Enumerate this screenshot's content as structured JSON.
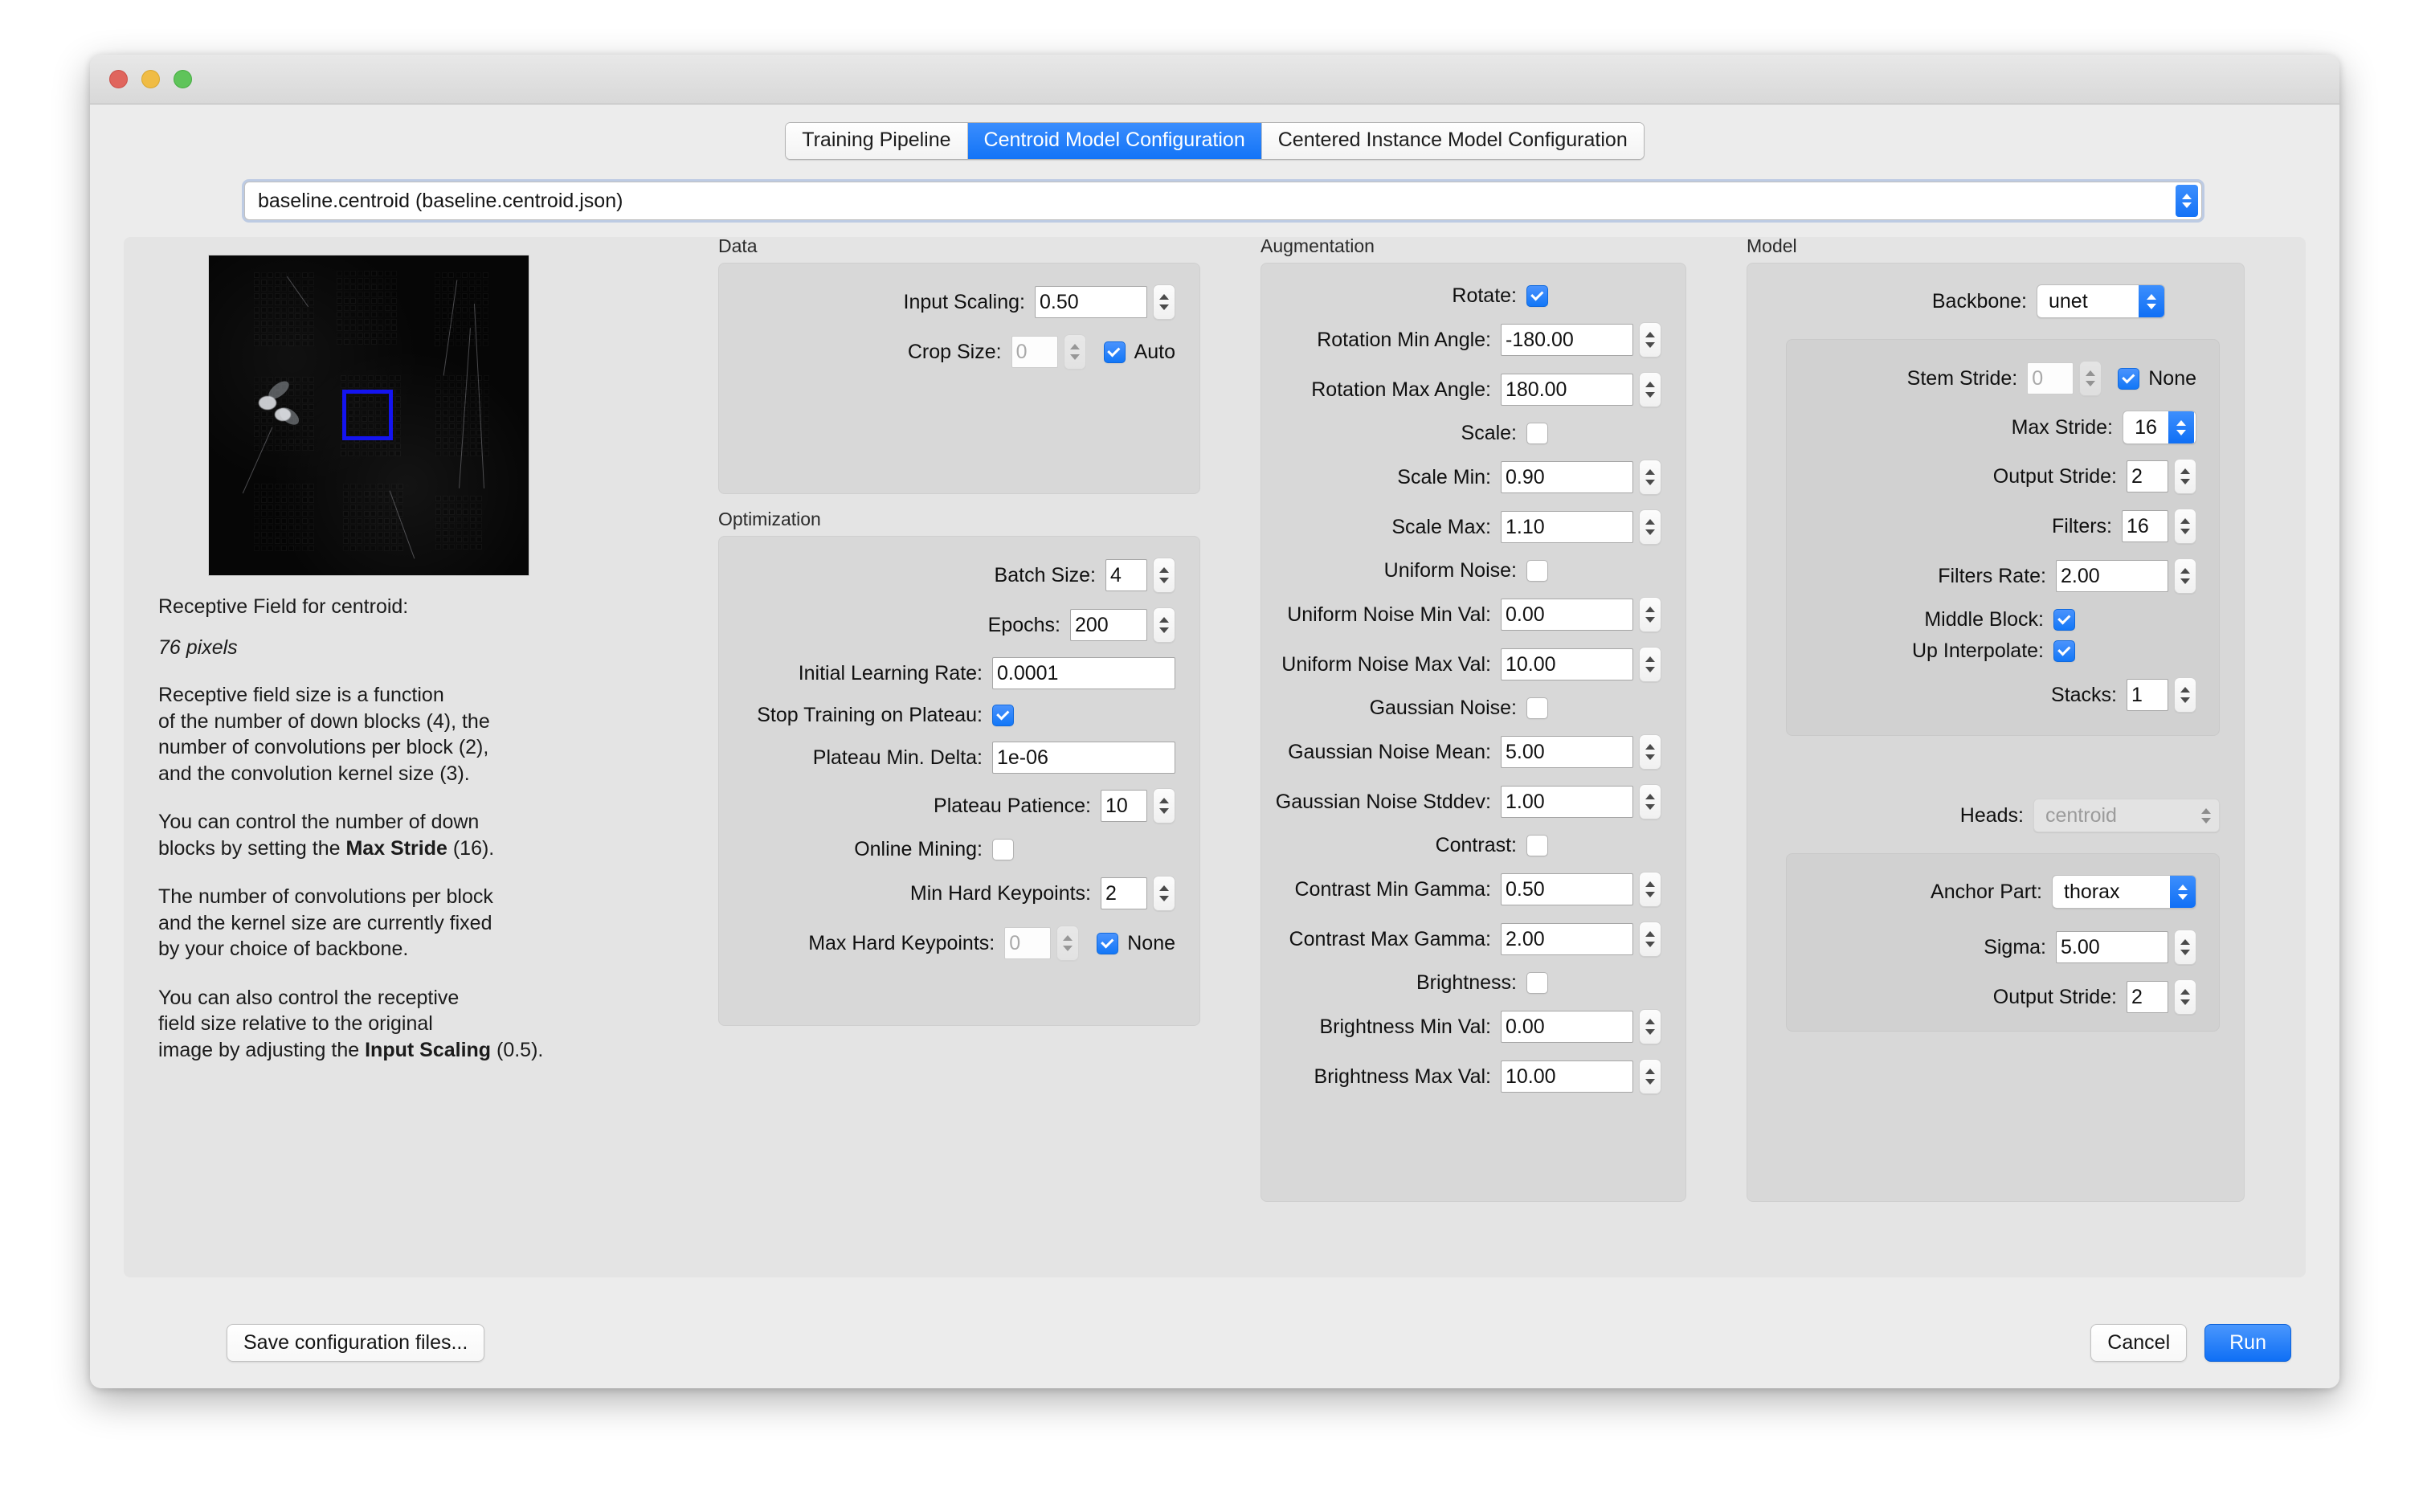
{
  "window": {
    "traffic_lights": [
      "close",
      "minimize",
      "zoom"
    ]
  },
  "tabs": [
    {
      "label": "Training Pipeline",
      "active": false
    },
    {
      "label": "Centroid Model Configuration",
      "active": true
    },
    {
      "label": "Centered Instance Model Configuration",
      "active": false
    }
  ],
  "config_selector": {
    "value": "baseline.centroid (baseline.centroid.json)"
  },
  "preview": {
    "caption_title": "Receptive Field for centroid:",
    "caption_value": "76 pixels",
    "para1_a": "Receptive field size is a function",
    "para1_b": "of the number of down blocks (4), the",
    "para1_c": "number of convolutions per block (2),",
    "para1_d": "and the convolution kernel size (3).",
    "para2_a": "You can control the number of down",
    "para2_b_pre": "blocks by setting the ",
    "para2_b_bold": "Max Stride",
    "para2_b_post": " (16).",
    "para3_a": "The number of convolutions per block",
    "para3_b": "and the kernel size are currently fixed",
    "para3_c": "by your choice of backbone.",
    "para4_a": "You can also control the receptive",
    "para4_b": "field size relative to the original",
    "para4_c_pre": "image by adjusting the ",
    "para4_c_bold": "Input Scaling",
    "para4_c_post": " (0.5)."
  },
  "data_section": {
    "title": "Data",
    "input_scaling": {
      "label": "Input Scaling:",
      "value": "0.50"
    },
    "crop_size": {
      "label": "Crop Size:",
      "value": "0",
      "disabled": true,
      "auto_label": "Auto",
      "auto_checked": true
    }
  },
  "optimization_section": {
    "title": "Optimization",
    "batch_size": {
      "label": "Batch Size:",
      "value": "4"
    },
    "epochs": {
      "label": "Epochs:",
      "value": "200"
    },
    "initial_learning_rate": {
      "label": "Initial Learning Rate:",
      "value": "0.0001"
    },
    "stop_training_on_plateau": {
      "label": "Stop Training on Plateau:",
      "checked": true
    },
    "plateau_min_delta": {
      "label": "Plateau Min. Delta:",
      "value": "1e-06"
    },
    "plateau_patience": {
      "label": "Plateau Patience:",
      "value": "10"
    },
    "online_mining": {
      "label": "Online Mining:",
      "checked": false
    },
    "min_hard_keypoints": {
      "label": "Min Hard Keypoints:",
      "value": "2"
    },
    "max_hard_keypoints": {
      "label": "Max Hard Keypoints:",
      "value": "0",
      "disabled": true,
      "none_label": "None",
      "none_checked": true
    }
  },
  "augmentation_section": {
    "title": "Augmentation",
    "rotate": {
      "label": "Rotate:",
      "checked": true
    },
    "rotation_min_angle": {
      "label": "Rotation Min Angle:",
      "value": "-180.00"
    },
    "rotation_max_angle": {
      "label": "Rotation Max Angle:",
      "value": "180.00"
    },
    "scale": {
      "label": "Scale:",
      "checked": false
    },
    "scale_min": {
      "label": "Scale Min:",
      "value": "0.90"
    },
    "scale_max": {
      "label": "Scale Max:",
      "value": "1.10"
    },
    "uniform_noise": {
      "label": "Uniform Noise:",
      "checked": false
    },
    "uniform_noise_min_val": {
      "label": "Uniform Noise Min Val:",
      "value": "0.00"
    },
    "uniform_noise_max_val": {
      "label": "Uniform Noise Max Val:",
      "value": "10.00"
    },
    "gaussian_noise": {
      "label": "Gaussian Noise:",
      "checked": false
    },
    "gaussian_noise_mean": {
      "label": "Gaussian Noise Mean:",
      "value": "5.00"
    },
    "gaussian_noise_stddev": {
      "label": "Gaussian Noise Stddev:",
      "value": "1.00"
    },
    "contrast": {
      "label": "Contrast:",
      "checked": false
    },
    "contrast_min_gamma": {
      "label": "Contrast Min Gamma:",
      "value": "0.50"
    },
    "contrast_max_gamma": {
      "label": "Contrast Max Gamma:",
      "value": "2.00"
    },
    "brightness": {
      "label": "Brightness:",
      "checked": false
    },
    "brightness_min_val": {
      "label": "Brightness Min Val:",
      "value": "0.00"
    },
    "brightness_max_val": {
      "label": "Brightness Max Val:",
      "value": "10.00"
    }
  },
  "model_section": {
    "title": "Model",
    "backbone": {
      "label": "Backbone:",
      "value": "unet"
    },
    "stem_stride": {
      "label": "Stem Stride:",
      "value": "0",
      "disabled": true,
      "none_label": "None",
      "none_checked": true
    },
    "max_stride": {
      "label": "Max Stride:",
      "value": "16"
    },
    "output_stride": {
      "label": "Output Stride:",
      "value": "2"
    },
    "filters": {
      "label": "Filters:",
      "value": "16"
    },
    "filters_rate": {
      "label": "Filters Rate:",
      "value": "2.00"
    },
    "middle_block": {
      "label": "Middle Block:",
      "checked": true
    },
    "up_interpolate": {
      "label": "Up Interpolate:",
      "checked": true
    },
    "stacks": {
      "label": "Stacks:",
      "value": "1"
    },
    "heads": {
      "label": "Heads:",
      "value": "centroid",
      "disabled": true
    },
    "anchor_part": {
      "label": "Anchor Part:",
      "value": "thorax"
    },
    "sigma": {
      "label": "Sigma:",
      "value": "5.00"
    },
    "head_output_stride": {
      "label": "Output Stride:",
      "value": "2"
    }
  },
  "footer": {
    "save_label": "Save configuration files...",
    "cancel_label": "Cancel",
    "run_label": "Run"
  },
  "colors": {
    "accent": "#1277f7",
    "window_bg": "#ececec",
    "panel_bg": "#d8d8d8",
    "receptive_box": "#1414f0"
  }
}
